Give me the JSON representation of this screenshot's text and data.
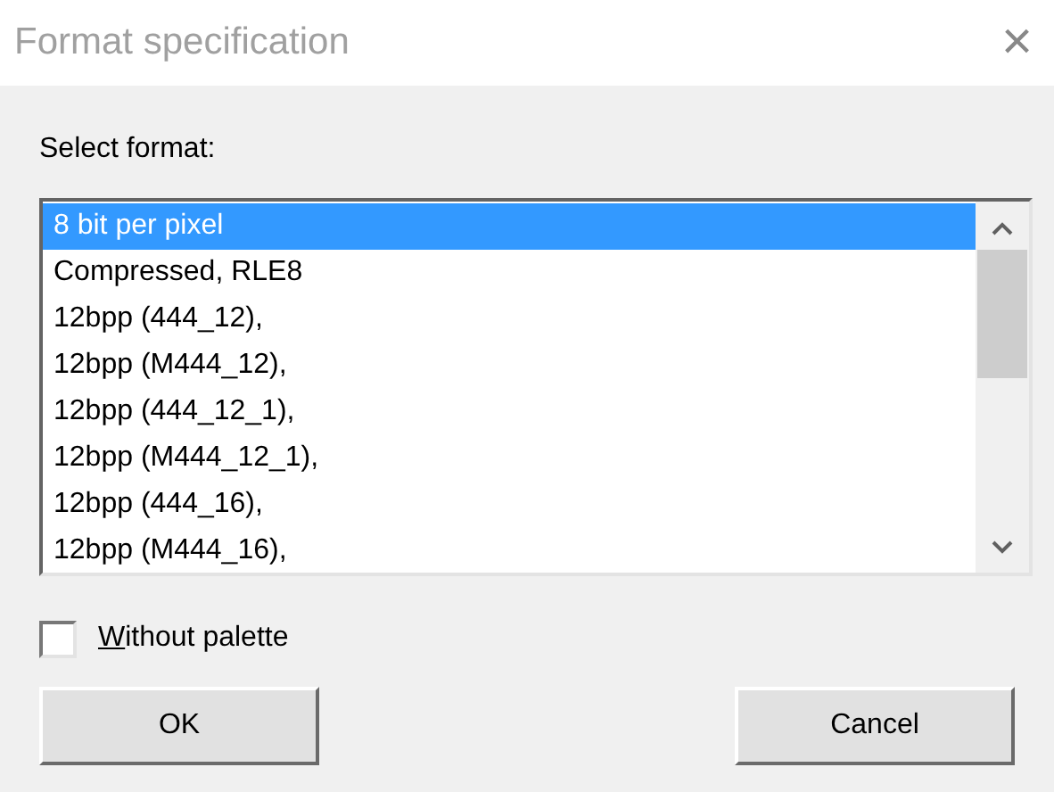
{
  "window": {
    "title": "Format specification",
    "close": "×"
  },
  "prompt": "Select format:",
  "formats": [
    {
      "label": "8 bit per pixel",
      "selected": true
    },
    {
      "label": "Compressed, RLE8",
      "selected": false
    },
    {
      "label": "12bpp (444_12),",
      "selected": false
    },
    {
      "label": "12bpp (M444_12),",
      "selected": false
    },
    {
      "label": "12bpp (444_12_1),",
      "selected": false
    },
    {
      "label": "12bpp (M444_12_1),",
      "selected": false
    },
    {
      "label": "12bpp (444_16),",
      "selected": false
    },
    {
      "label": "12bpp (M444_16),",
      "selected": false
    }
  ],
  "without_palette": {
    "mnemonic": "W",
    "rest": "ithout palette",
    "checked": false
  },
  "buttons": [
    {
      "label": "OK"
    },
    {
      "label": "Cancel"
    }
  ]
}
